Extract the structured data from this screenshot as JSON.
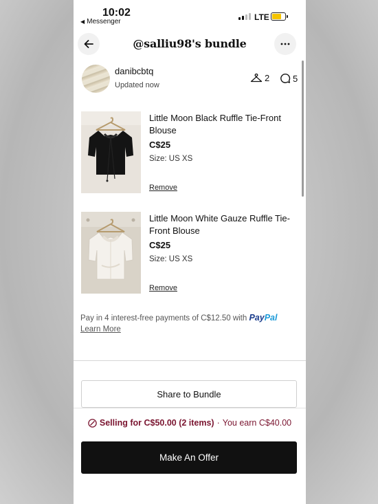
{
  "status_bar": {
    "time": "10:02",
    "back_app": "Messenger",
    "network": "LTE"
  },
  "header": {
    "title": "@salliu98's bundle",
    "back_icon": "arrow-left-icon",
    "more_icon": "more-horizontal-icon"
  },
  "seller": {
    "username": "danibcbtq",
    "updated": "Updated now",
    "likes_count": "2",
    "comments_count": "5"
  },
  "items": [
    {
      "title": "Little Moon Black Ruffle Tie-Front Blouse",
      "price": "C$25",
      "size": "Size: US XS",
      "remove_label": "Remove"
    },
    {
      "title": "Little Moon White Gauze Ruffle Tie-Front Blouse",
      "price": "C$25",
      "size": "Size: US XS",
      "remove_label": "Remove"
    }
  ],
  "paypal": {
    "text": "Pay in 4 interest-free payments of C$12.50 with",
    "logo_pay": "Pay",
    "logo_pal": "Pal",
    "learn_more": "Learn More"
  },
  "share_button": "Share to Bundle",
  "footer": {
    "selling": "Selling for C$50.00 (2 items)",
    "separator": "·",
    "earn": "You earn C$40.00",
    "offer_button": "Make An Offer"
  },
  "colors": {
    "accent": "#7a1530",
    "paypal_dark": "#1a3c8c",
    "paypal_light": "#1d9bd9",
    "battery": "#f5c400",
    "button_dark": "#111111"
  }
}
